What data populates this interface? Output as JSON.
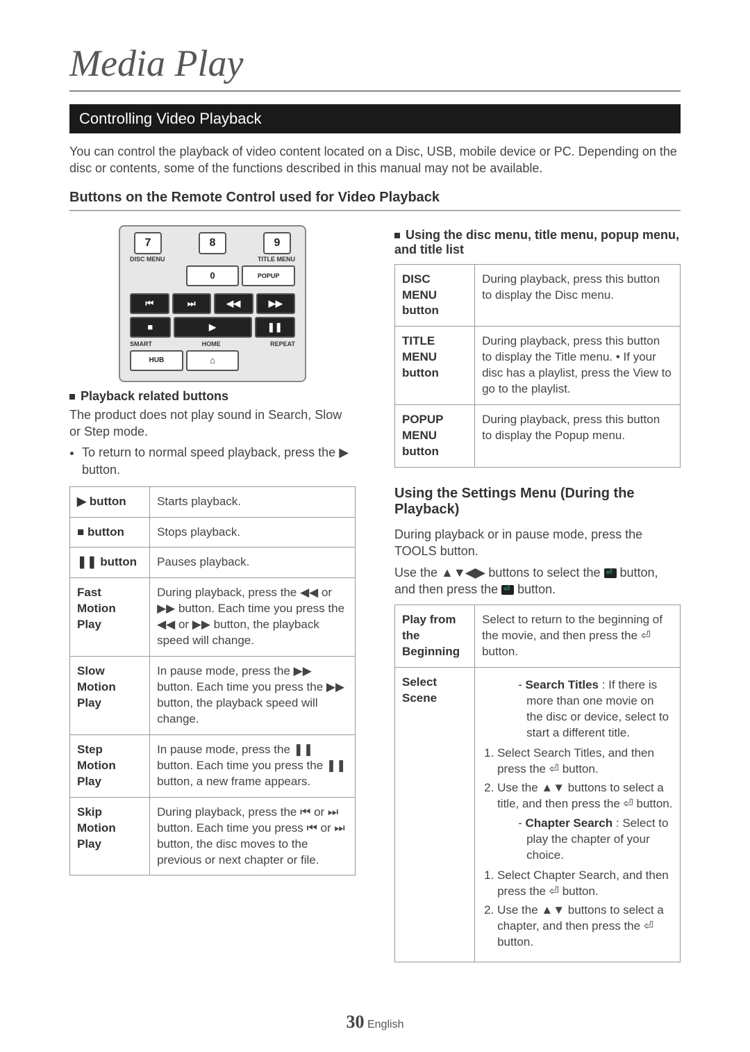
{
  "page": {
    "title": "Media Play",
    "section_bar": "Controlling Video Playback",
    "number": "30",
    "lang": "English"
  },
  "intro": "You can control the playback of video content located on a Disc, USB, mobile device or PC. Depending on the disc or contents, some of the functions described in this manual may not be available.",
  "sub_heading": "Buttons on the Remote Control used for Video Playback",
  "remote": {
    "nums": [
      "7",
      "8",
      "9"
    ],
    "labels_top": [
      "DISC MENU",
      "",
      "TITLE MENU"
    ],
    "row2": [
      "",
      "0",
      "POPUP"
    ],
    "nav": [
      "⏮",
      "⏭",
      "◀◀",
      "▶▶"
    ],
    "play_row": [
      "■",
      "▶",
      "❚❚"
    ],
    "labels_bottom": [
      "SMART",
      "HOME",
      "REPEAT"
    ],
    "hub": "HUB",
    "home_icon": "⌂"
  },
  "left": {
    "mini_head": "Playback related buttons",
    "para": "The product does not play sound in Search, Slow or Step mode.",
    "bullet": "To return to normal speed playback, press the ▶ button.",
    "table": [
      {
        "name": "▶ button",
        "desc": "Starts playback."
      },
      {
        "name": "■ button",
        "desc": "Stops playback."
      },
      {
        "name": "❚❚ button",
        "desc": "Pauses playback."
      },
      {
        "name": "Fast Motion Play",
        "desc": "During playback, press the ◀◀ or ▶▶ button.\nEach time you press the ◀◀ or ▶▶ button, the playback speed will change."
      },
      {
        "name": "Slow Motion Play",
        "desc": "In pause mode, press the ▶▶ button. Each time you press the ▶▶ button, the playback speed will change."
      },
      {
        "name": "Step Motion Play",
        "desc": "In pause mode, press the ❚❚ button. Each time you press the ❚❚ button, a new frame appears."
      },
      {
        "name": "Skip Motion Play",
        "desc": "During playback, press the ⏮ or ⏭ button.\nEach time you press ⏮ or ⏭ button, the disc moves to the previous or next chapter or file."
      }
    ]
  },
  "right": {
    "mini_head": "Using the disc menu, title menu, popup menu, and title list",
    "menu_table": [
      {
        "name": "DISC MENU button",
        "desc": "During playback, press this button to display the Disc menu."
      },
      {
        "name": "TITLE MENU button",
        "desc": "During playback, press this button to display the Title menu.\n• If your disc has a playlist, press the View to go to the playlist."
      },
      {
        "name": "POPUP MENU button",
        "desc": "During playback, press this button to display the Popup menu."
      }
    ],
    "settings_head": "Using the Settings Menu (During the Playback)",
    "settings_p1": "During playback or in pause mode, press the TOOLS button.",
    "settings_p2_a": "Use the ",
    "settings_p2_arrows": "▲▼◀▶",
    "settings_p2_b": " buttons to select the ",
    "settings_p2_c": " button, and then press the ",
    "settings_p2_d": " button.",
    "set_table": {
      "r1": {
        "name": "Play from the Beginning",
        "desc": "Select to return to the beginning of the movie, and then press the ⏎ button."
      },
      "r2": {
        "name": "Select Scene",
        "search_titles_intro": "Search Titles : If there is more than one movie on the disc or device, select to start a different title.",
        "search_titles_steps": [
          "Select Search Titles, and then press the ⏎ button.",
          "Use the ▲▼ buttons to select a title, and then press the ⏎ button."
        ],
        "chapter_search_intro": "Chapter Search : Select to play the chapter of your choice.",
        "chapter_search_steps": [
          "Select Chapter Search, and then press the ⏎ button.",
          "Use the ▲▼ buttons to select a chapter, and then press the ⏎ button."
        ]
      }
    }
  }
}
